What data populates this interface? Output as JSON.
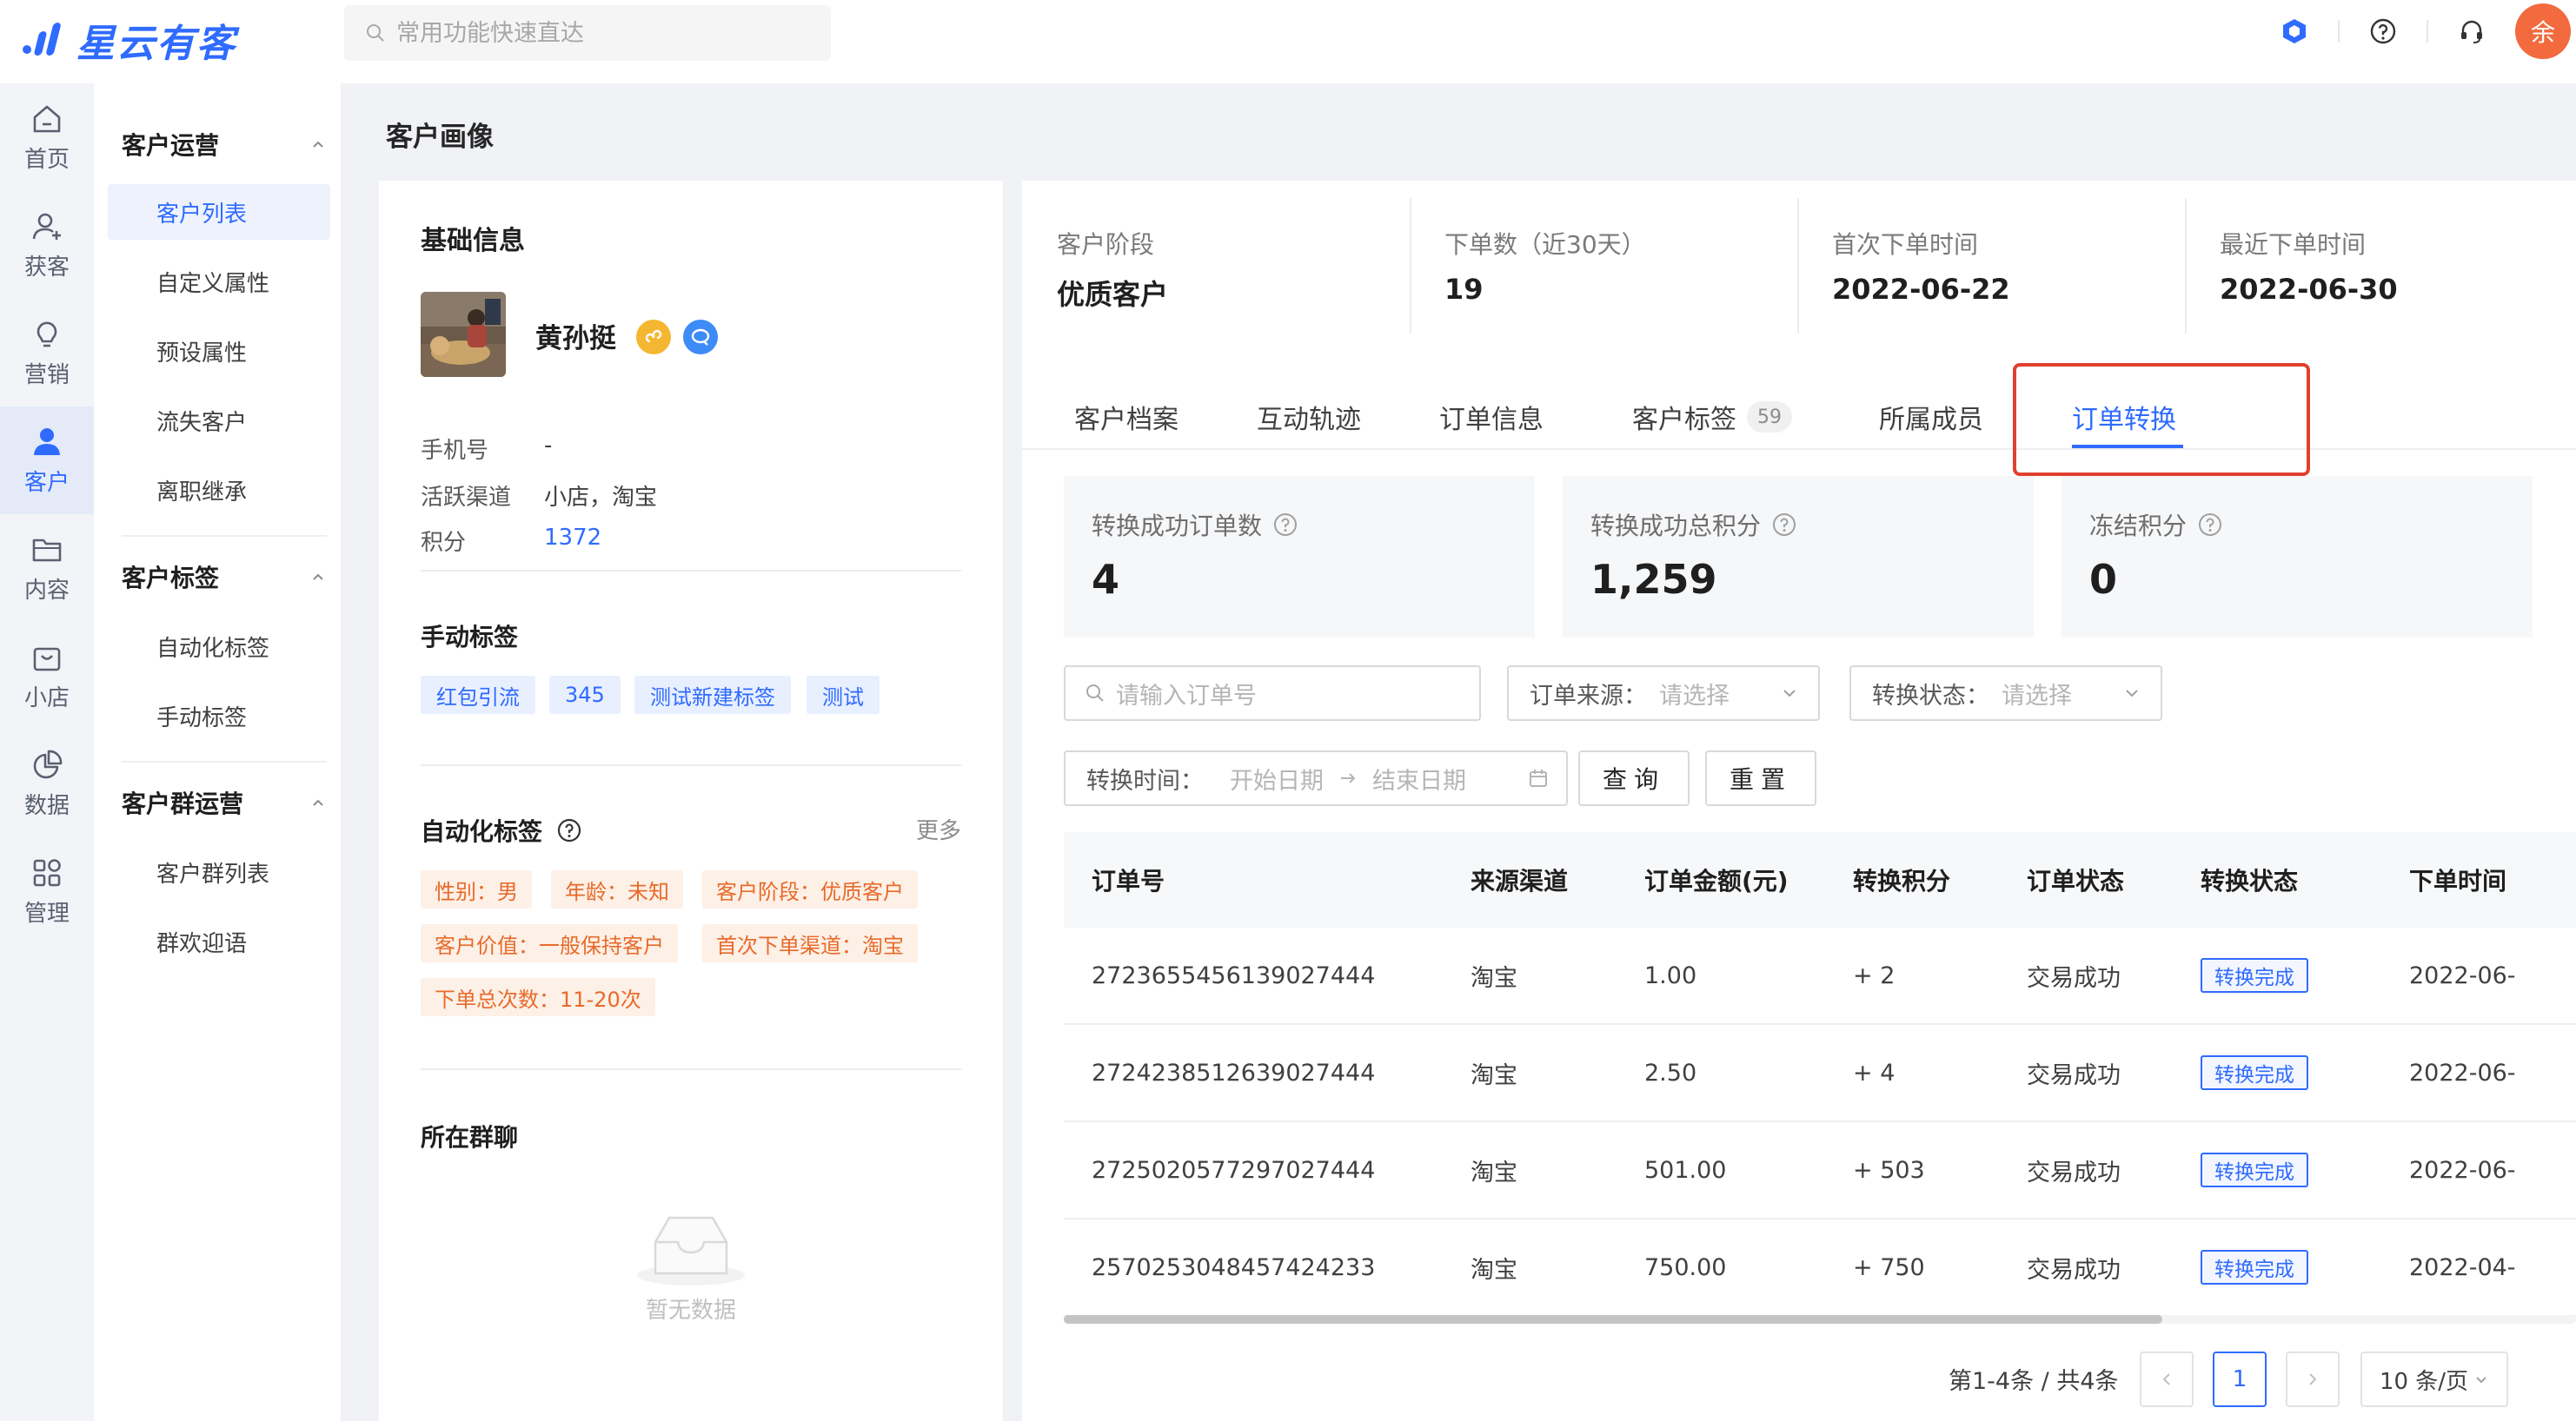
{
  "brand": {
    "logo_text": "星云有客",
    "accent": "#2f6bff"
  },
  "search": {
    "placeholder": "常用功能快速直达"
  },
  "topbar": {
    "user_avatar_text": "余"
  },
  "rail": [
    {
      "label": "首页",
      "icon": "home-icon"
    },
    {
      "label": "获客",
      "icon": "user-add-icon"
    },
    {
      "label": "营销",
      "icon": "bulb-icon"
    },
    {
      "label": "客户",
      "icon": "user-icon",
      "active": true
    },
    {
      "label": "内容",
      "icon": "folder-icon"
    },
    {
      "label": "小店",
      "icon": "shop-icon"
    },
    {
      "label": "数据",
      "icon": "pie-chart-icon"
    },
    {
      "label": "管理",
      "icon": "grid-icon"
    }
  ],
  "submenu": {
    "groups": [
      {
        "title": "客户运营",
        "items": [
          "客户列表",
          "自定义属性",
          "预设属性",
          "流失客户",
          "离职继承"
        ]
      },
      {
        "title": "客户标签",
        "items": [
          "自动化标签",
          "手动标签"
        ]
      },
      {
        "title": "客户群运营",
        "items": [
          "客户群列表",
          "群欢迎语"
        ]
      }
    ],
    "active_item": "客户列表"
  },
  "page": {
    "title": "客户画像"
  },
  "basic_info": {
    "title": "基础信息",
    "name": "黄孙挺",
    "fields": [
      {
        "label": "手机号",
        "value": "-"
      },
      {
        "label": "活跃渠道",
        "value": "小店，淘宝"
      },
      {
        "label": "积分",
        "value": "1372"
      }
    ]
  },
  "manual_tags": {
    "title": "手动标签",
    "tags": [
      "红包引流",
      "345",
      "测试新建标签",
      "测试"
    ]
  },
  "auto_tags": {
    "title": "自动化标签",
    "more": "更多",
    "tags": [
      "性别：男",
      "年龄：未知",
      "客户阶段：优质客户",
      "客户价值：一般保持客户",
      "首次下单渠道：淘宝",
      "下单总次数：11-20次"
    ]
  },
  "groups_section": {
    "title": "所在群聊",
    "empty_text": "暂无数据"
  },
  "stats": [
    {
      "label": "客户阶段",
      "value": "优质客户"
    },
    {
      "label": "下单数（近30天）",
      "value": "19"
    },
    {
      "label": "首次下单时间",
      "value": "2022-06-22"
    },
    {
      "label": "最近下单时间",
      "value": "2022-06-30"
    }
  ],
  "tabs": [
    {
      "label": "客户档案"
    },
    {
      "label": "互动轨迹"
    },
    {
      "label": "订单信息"
    },
    {
      "label": "客户标签",
      "count": "59"
    },
    {
      "label": "所属成员"
    },
    {
      "label": "订单转换",
      "active": true
    }
  ],
  "metrics": [
    {
      "label": "转换成功订单数",
      "value": "4"
    },
    {
      "label": "转换成功总积分",
      "value": "1,259"
    },
    {
      "label": "冻结积分",
      "value": "0"
    }
  ],
  "filters": {
    "order_no_placeholder": "请输入订单号",
    "source_label": "订单来源：",
    "source_placeholder": "请选择",
    "status_label": "转换状态：",
    "status_placeholder": "请选择",
    "time_label": "转换时间：",
    "start_placeholder": "开始日期",
    "end_placeholder": "结束日期",
    "query_button": "查询",
    "reset_button": "重置"
  },
  "table": {
    "columns": [
      "订单号",
      "来源渠道",
      "订单金额(元)",
      "转换积分",
      "订单状态",
      "转换状态",
      "下单时间"
    ],
    "rows": [
      [
        "2723655456139027444",
        "淘宝",
        "1.00",
        "+ 2",
        "交易成功",
        "转换完成",
        "2022-06-"
      ],
      [
        "2724238512639027444",
        "淘宝",
        "2.50",
        "+ 4",
        "交易成功",
        "转换完成",
        "2022-06-"
      ],
      [
        "2725020577297027444",
        "淘宝",
        "501.00",
        "+ 503",
        "交易成功",
        "转换完成",
        "2022-06-"
      ],
      [
        "2570253048457424233",
        "淘宝",
        "750.00",
        "+ 750",
        "交易成功",
        "转换完成",
        "2022-04-"
      ]
    ]
  },
  "pagination": {
    "total_text": "第1-4条 / 共4条",
    "current_page": "1",
    "page_size": "10 条/页"
  }
}
